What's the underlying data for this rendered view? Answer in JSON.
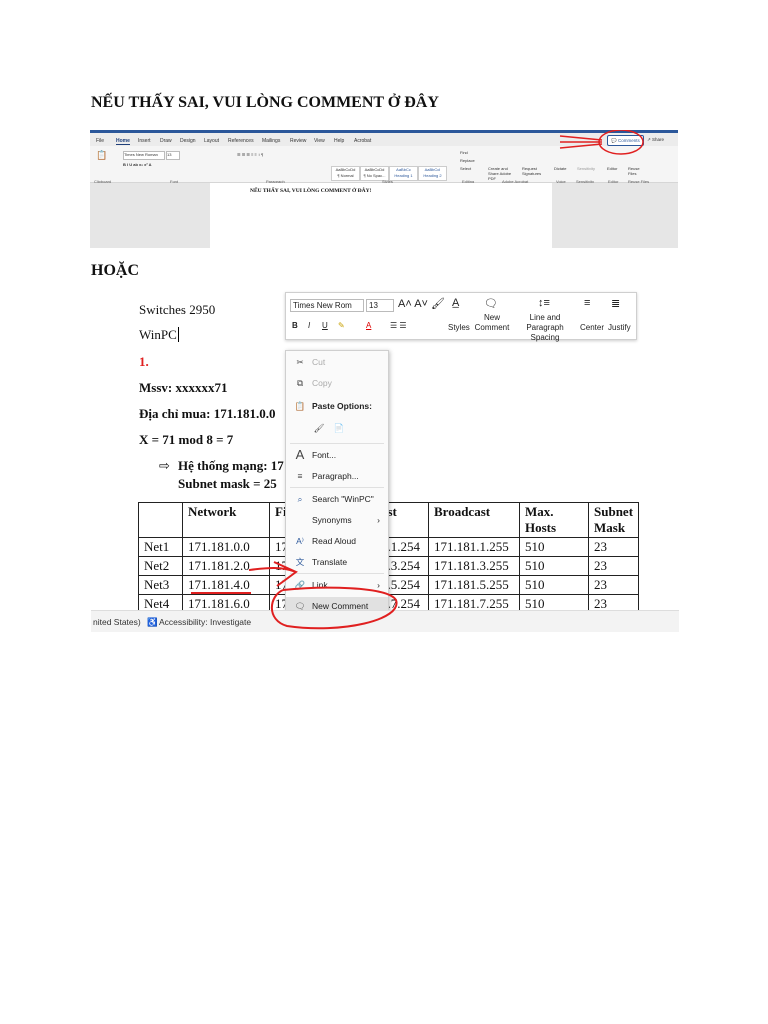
{
  "title": "NẾU THẤY SAI, VUI LÒNG COMMENT Ở ĐÂY",
  "separator": "HOẶC",
  "shot1": {
    "tabs": [
      "File",
      "Home",
      "Insert",
      "Draw",
      "Design",
      "Layout",
      "References",
      "Mailings",
      "Review",
      "View",
      "Help",
      "Acrobat"
    ],
    "font_name": "Times New Roman",
    "font_size": "13",
    "styles": [
      "AaBbCcDd",
      "AaBbCcDd",
      "AaBbCc",
      "AaBbCcI"
    ],
    "style_names": [
      "¶ Normal",
      "¶ No Spac...",
      "Heading 1",
      "Heading 2"
    ],
    "group_labels": [
      "Clipboard",
      "Font",
      "Paragraph",
      "Styles",
      "Editing",
      "Adobe Acrobat",
      "Voice",
      "Sensitivity",
      "Editor",
      "Reuse Files"
    ],
    "editing": [
      "Find",
      "Replace",
      "Select"
    ],
    "right_tools": [
      "Create and Share Adobe PDF",
      "Request Signatures",
      "Dictate",
      "Sensitivity",
      "Editor",
      "Reuse Files"
    ],
    "comments_label": "Comments",
    "share_label": "Share",
    "doc_title": "NẾU THẤY SAI, VUI LÒNG COMMENT Ở ĐÂY!"
  },
  "shot2": {
    "lines": {
      "switches": "Switches 2950",
      "winpc": "WinPC",
      "num": "1.",
      "mssv": "Mssv: xxxxxx71",
      "diachi": "Địa chỉ mua: 171.181.0.0",
      "x": "X = 71 mod 8 = 7",
      "arrow": "⇨",
      "hethong": "Hệ thống mạng: 17",
      "subnet": "Subnet mask = 25"
    },
    "mini_toolbar": {
      "font": "Times New Rom",
      "size": "13",
      "styles": "Styles",
      "new_comment": "New Comment",
      "line_spacing": "Line and Paragraph Spacing",
      "center": "Center",
      "justify": "Justify"
    },
    "context_menu": {
      "cut": "Cut",
      "copy": "Copy",
      "paste_options": "Paste Options:",
      "font": "Font...",
      "paragraph": "Paragraph...",
      "search": "Search \"WinPC\"",
      "synonyms": "Synonyms",
      "read_aloud": "Read Aloud",
      "translate": "Translate",
      "link": "Link",
      "new_comment": "New Comment"
    },
    "table": {
      "headers": [
        "",
        "Network",
        "Fi",
        "ost",
        "Broadcast",
        "Max. Hosts",
        "Subnet Mask"
      ],
      "rows": [
        [
          "Net1",
          "171.181.0.0",
          "17",
          "1.1.254",
          "171.181.1.255",
          "510",
          "23"
        ],
        [
          "Net2",
          "171.181.2.0",
          "17",
          "1.3.254",
          "171.181.3.255",
          "510",
          "23"
        ],
        [
          "Net3",
          "171.181.4.0",
          "17",
          "1.5.254",
          "171.181.5.255",
          "510",
          "23"
        ],
        [
          "Net4",
          "171.181.6.0",
          "17",
          "1.7.254",
          "171.181.7.255",
          "510",
          "23"
        ]
      ]
    },
    "status": {
      "lang": "nited States)",
      "accessibility": "Accessibility: Investigate"
    }
  },
  "colors": {
    "accent": "#2b579a",
    "annotation": "#e02020"
  }
}
